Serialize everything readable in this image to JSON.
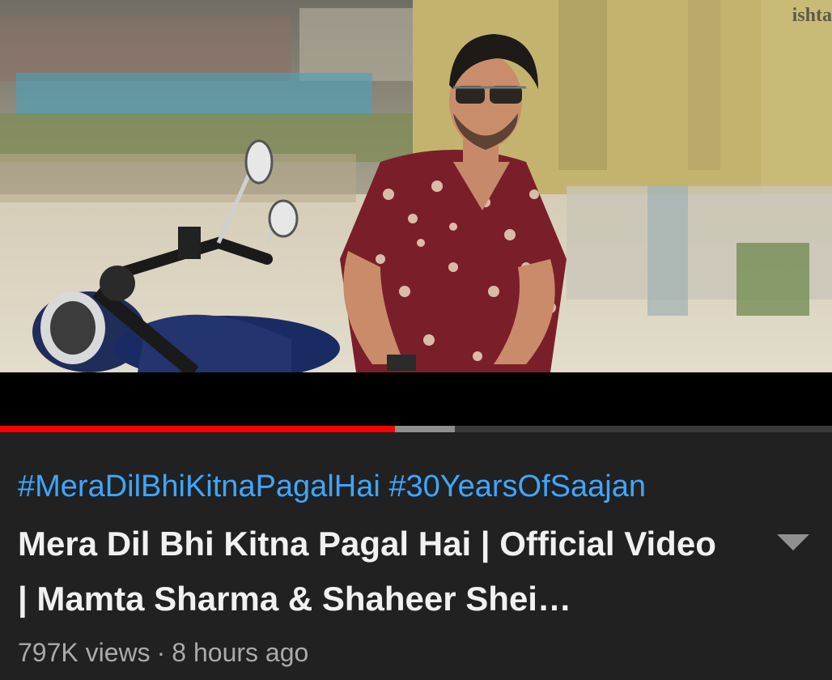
{
  "player": {
    "watermark": "ishta",
    "progress": {
      "played_fraction": 0.475,
      "buffered_fraction": 0.547
    },
    "colors": {
      "played": "#ff0000",
      "buffered": "#8e8e8e",
      "track": "#3a3a3a"
    }
  },
  "video": {
    "hashtags": [
      "#MeraDilBhiKitnaPagalHai",
      "#30YearsOfSaajan"
    ],
    "title": "Mera Dil Bhi Kitna Pagal Hai | Official Video | Mamta Sharma & Shaheer Shei…",
    "views": "797K views",
    "separator": "·",
    "age": "8 hours ago"
  },
  "icons": {
    "expand": "chevron-down-icon"
  },
  "colors": {
    "hashtag": "#3ea6ff",
    "title": "#f1f1f1",
    "meta": "#aaaaaa",
    "background": "#212121"
  }
}
